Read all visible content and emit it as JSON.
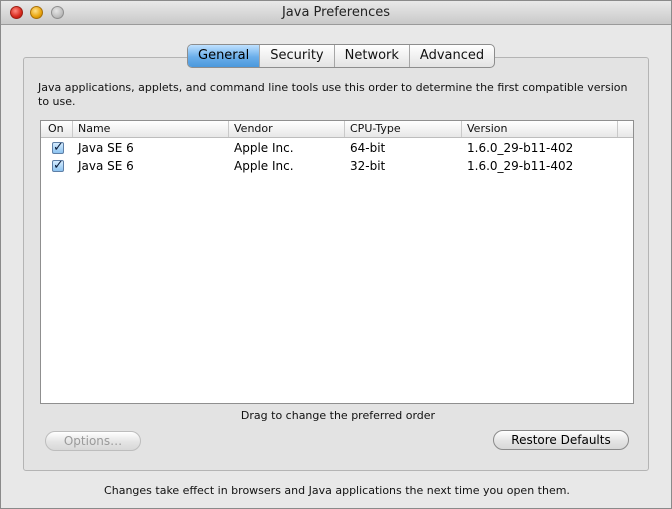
{
  "window": {
    "title": "Java Preferences"
  },
  "tabs": [
    {
      "label": "General",
      "active": true
    },
    {
      "label": "Security",
      "active": false
    },
    {
      "label": "Network",
      "active": false
    },
    {
      "label": "Advanced",
      "active": false
    }
  ],
  "general": {
    "description": "Java applications, applets, and command line tools use this order to determine the first compatible version to use.",
    "table": {
      "columns": [
        "On",
        "Name",
        "Vendor",
        "CPU-Type",
        "Version"
      ],
      "rows": [
        {
          "on": true,
          "name": "Java SE 6",
          "vendor": "Apple Inc.",
          "cpu": "64-bit",
          "version": "1.6.0_29-b11-402"
        },
        {
          "on": true,
          "name": "Java SE 6",
          "vendor": "Apple Inc.",
          "cpu": "32-bit",
          "version": "1.6.0_29-b11-402"
        }
      ]
    },
    "hint": "Drag to change the preferred order",
    "options_label": "Options…",
    "restore_label": "Restore Defaults"
  },
  "footer": "Changes take effect in browsers and Java applications the next time you open them.",
  "colors": {
    "tab_active": "#4b98dc",
    "window_bg": "#e8e8e8"
  }
}
